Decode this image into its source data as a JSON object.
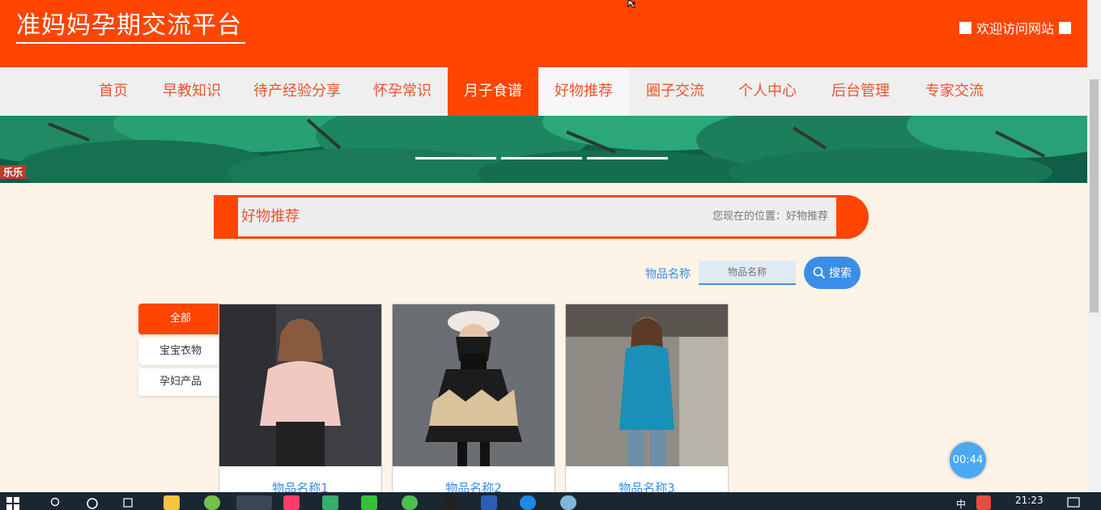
{
  "header": {
    "site_title": "准妈妈孕期交流平台",
    "welcome": "欢迎访问网站"
  },
  "nav": {
    "items": [
      {
        "label": "首页"
      },
      {
        "label": "早教知识"
      },
      {
        "label": "待产经验分享"
      },
      {
        "label": "怀孕常识"
      },
      {
        "label": "月子食谱"
      },
      {
        "label": "好物推荐"
      },
      {
        "label": "圈子交流"
      },
      {
        "label": "个人中心"
      },
      {
        "label": "后台管理"
      },
      {
        "label": "专家交流"
      }
    ],
    "active": "月子食谱"
  },
  "section": {
    "title": "好物推荐",
    "breadcrumb": "您现在的位置：好物推荐"
  },
  "search": {
    "label": "物品名称",
    "placeholder": "物品名称",
    "button": "搜索"
  },
  "categories": [
    {
      "label": "全部"
    },
    {
      "label": "宝宝衣物"
    },
    {
      "label": "孕妇产品"
    }
  ],
  "products": [
    {
      "name": "物品名称1"
    },
    {
      "name": "物品名称2"
    },
    {
      "name": "物品名称3"
    }
  ],
  "timer": "00:44",
  "taskbar": {
    "clock": "21:23",
    "ime": "中"
  },
  "colors": {
    "primary": "#ff4500",
    "accent_blue": "#3a8ee6",
    "page_bg": "#fdf3e7"
  }
}
